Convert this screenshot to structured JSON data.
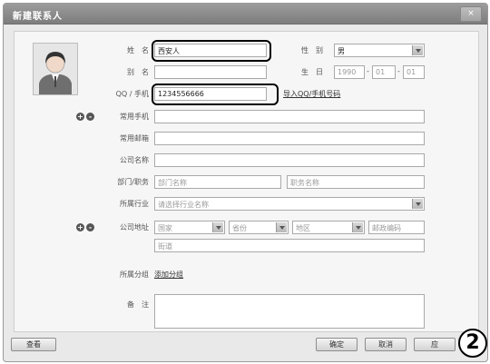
{
  "window": {
    "title": "新建联系人",
    "close_label": "×"
  },
  "form": {
    "name": {
      "label": "姓　名",
      "value": "西安人"
    },
    "alias": {
      "label": "别　名",
      "value": ""
    },
    "phone": {
      "label": "QQ / 手机",
      "value": "1234556666"
    },
    "gender": {
      "label": "性　别",
      "value": "男"
    },
    "birthday": {
      "label": "生　日",
      "year": "1990",
      "month": "01",
      "day": "01",
      "sep": "-"
    },
    "import_link": "导入QQ/手机号码",
    "mobile": {
      "label": "常用手机",
      "value": ""
    },
    "email": {
      "label": "常用邮箱",
      "value": ""
    },
    "company": {
      "label": "公司名称",
      "value": ""
    },
    "dept": {
      "label": "部门/职务",
      "dept_placeholder": "部门名称",
      "title_placeholder": "职务名称"
    },
    "industry": {
      "label": "所属行业",
      "value": "请选择行业名称"
    },
    "address": {
      "label": "公司地址",
      "country": "国家",
      "province": "省份",
      "city": "地区",
      "zip_placeholder": "邮政编码",
      "street_placeholder": "街道"
    },
    "group": {
      "label": "所属分组",
      "link": "添加分组"
    },
    "note": {
      "label": "备　注",
      "value": ""
    }
  },
  "footer": {
    "help_label": "查看",
    "ok_label": "确定",
    "cancel_label": "取消",
    "other_label": "应"
  },
  "annotation": {
    "badge": "2"
  }
}
